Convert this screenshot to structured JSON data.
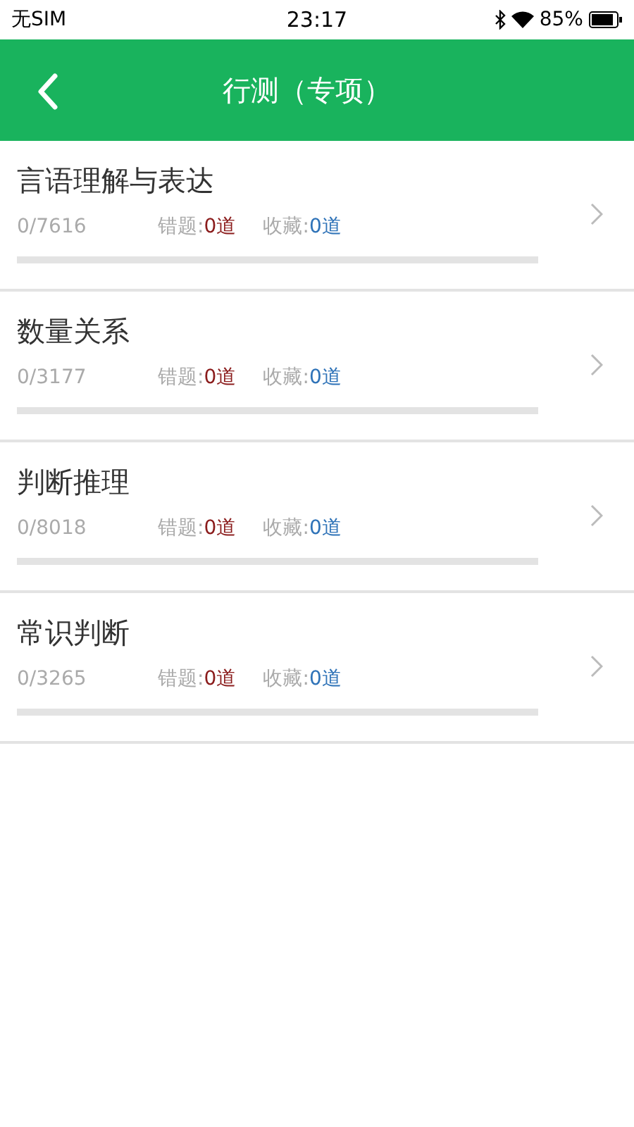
{
  "status_bar": {
    "carrier": "无SIM",
    "time": "23:17",
    "battery": "85%"
  },
  "header": {
    "title": "行测（专项）"
  },
  "subjects": [
    {
      "name": "言语理解与表达",
      "progress": "0/7616",
      "wrong_label": "错题:",
      "wrong_count": "0道",
      "fav_label": "收藏:",
      "fav_count": "0道",
      "level": 0
    },
    {
      "name": "数量关系",
      "progress": "0/3177",
      "wrong_label": "错题:",
      "wrong_count": "0道",
      "fav_label": "收藏:",
      "fav_count": "0道",
      "level": 0
    },
    {
      "name": "判断推理",
      "progress": "0/8018",
      "wrong_label": "错题:",
      "wrong_count": "0道",
      "fav_label": "收藏:",
      "fav_count": "0道",
      "level": 0
    },
    {
      "name": "常识判断",
      "progress": "0/3265",
      "wrong_label": "错题:",
      "wrong_count": "0道",
      "fav_label": "收藏:",
      "fav_count": "0道",
      "level": 0
    }
  ]
}
